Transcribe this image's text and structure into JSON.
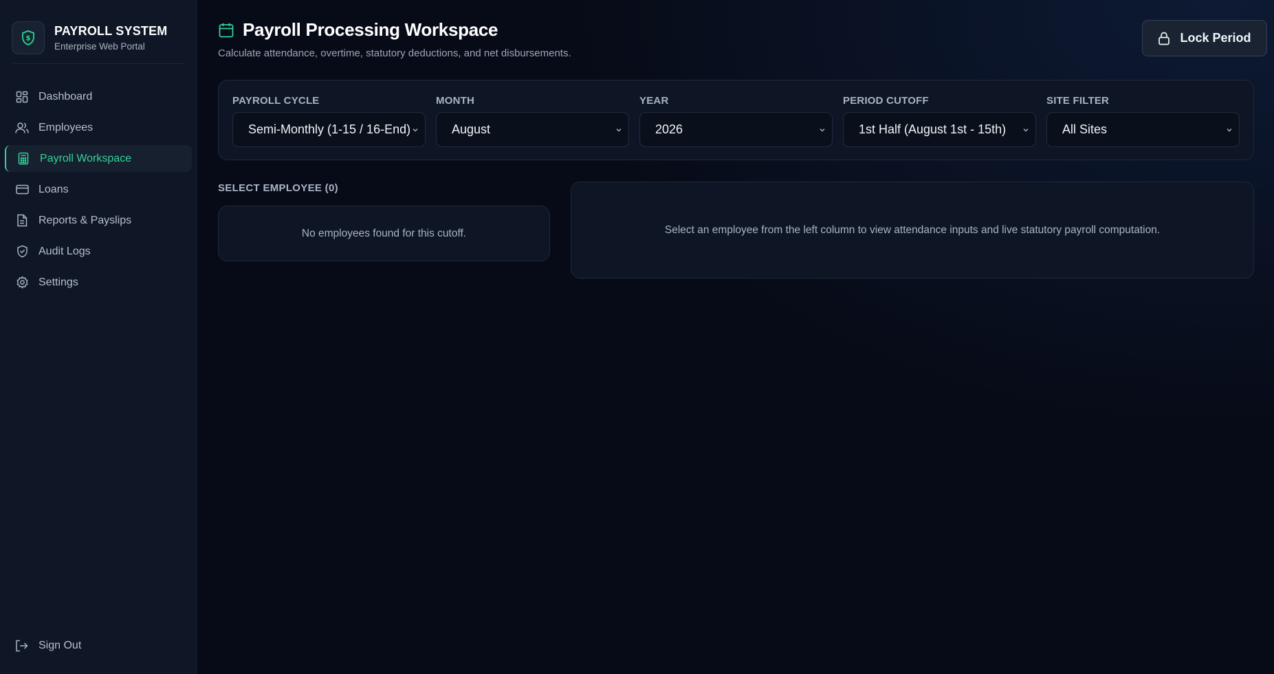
{
  "brand": {
    "title": "PAYROLL SYSTEM",
    "subtitle": "Enterprise Web Portal",
    "logo_icon": "shield-dollar-icon"
  },
  "sidebar": {
    "items": [
      {
        "label": "Dashboard",
        "icon": "dashboard-icon",
        "active": false
      },
      {
        "label": "Employees",
        "icon": "users-icon",
        "active": false
      },
      {
        "label": "Payroll Workspace",
        "icon": "calculator-icon",
        "active": true
      },
      {
        "label": "Loans",
        "icon": "credit-card-icon",
        "active": false
      },
      {
        "label": "Reports & Payslips",
        "icon": "file-icon",
        "active": false
      },
      {
        "label": "Audit Logs",
        "icon": "shield-check-icon",
        "active": false
      },
      {
        "label": "Settings",
        "icon": "gear-icon",
        "active": false
      }
    ],
    "signout_label": "Sign Out"
  },
  "header": {
    "title": "Payroll Processing Workspace",
    "description": "Calculate attendance, overtime, statutory deductions, and net disbursements.",
    "lock_button_label": "Lock Period"
  },
  "filters": {
    "payroll_cycle": {
      "label": "PAYROLL CYCLE",
      "value": "Semi-Monthly (1-15 / 16-End)"
    },
    "month": {
      "label": "MONTH",
      "value": "August"
    },
    "year": {
      "label": "YEAR",
      "value": "2026"
    },
    "period_cutoff": {
      "label": "PERIOD CUTOFF",
      "value": "1st Half (August 1st - 15th)"
    },
    "site_filter": {
      "label": "SITE FILTER",
      "value": "All Sites"
    }
  },
  "employees": {
    "heading": "SELECT EMPLOYEE (0)",
    "empty_message": "No employees found for this cutoff."
  },
  "detail": {
    "placeholder": "Select an employee from the left column to view attendance inputs and live statutory payroll computation."
  },
  "colors": {
    "accent": "#34d399",
    "background": "#070b17",
    "panel": "#0e1525"
  }
}
